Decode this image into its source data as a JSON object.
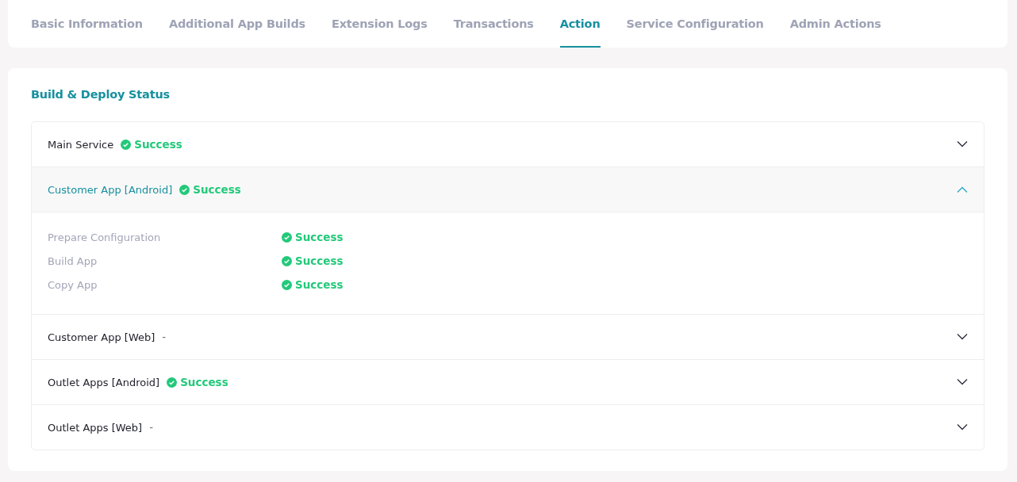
{
  "tabs": [
    {
      "label": "Basic Information",
      "selected": false
    },
    {
      "label": "Additional App Builds",
      "selected": false
    },
    {
      "label": "Extension Logs",
      "selected": false
    },
    {
      "label": "Transactions",
      "selected": false
    },
    {
      "label": "Action",
      "selected": true
    },
    {
      "label": "Service Configuration",
      "selected": false
    },
    {
      "label": "Admin Actions",
      "selected": false
    }
  ],
  "section": {
    "title": "Build & Deploy Status"
  },
  "items": [
    {
      "name": "Main Service",
      "status": {
        "kind": "success",
        "text": "Success"
      },
      "expanded": false
    },
    {
      "name": "Customer App [Android]",
      "status": {
        "kind": "success",
        "text": "Success"
      },
      "expanded": true,
      "steps": [
        {
          "name": "Prepare Configuration",
          "status": {
            "kind": "success",
            "text": "Success"
          }
        },
        {
          "name": "Build App",
          "status": {
            "kind": "success",
            "text": "Success"
          }
        },
        {
          "name": "Copy App",
          "status": {
            "kind": "success",
            "text": "Success"
          }
        }
      ]
    },
    {
      "name": "Customer App [Web]",
      "status": {
        "kind": "none",
        "text": "-"
      },
      "expanded": false
    },
    {
      "name": "Outlet Apps [Android]",
      "status": {
        "kind": "success",
        "text": "Success"
      },
      "expanded": false
    },
    {
      "name": "Outlet Apps [Web]",
      "status": {
        "kind": "none",
        "text": "-"
      },
      "expanded": false
    }
  ]
}
